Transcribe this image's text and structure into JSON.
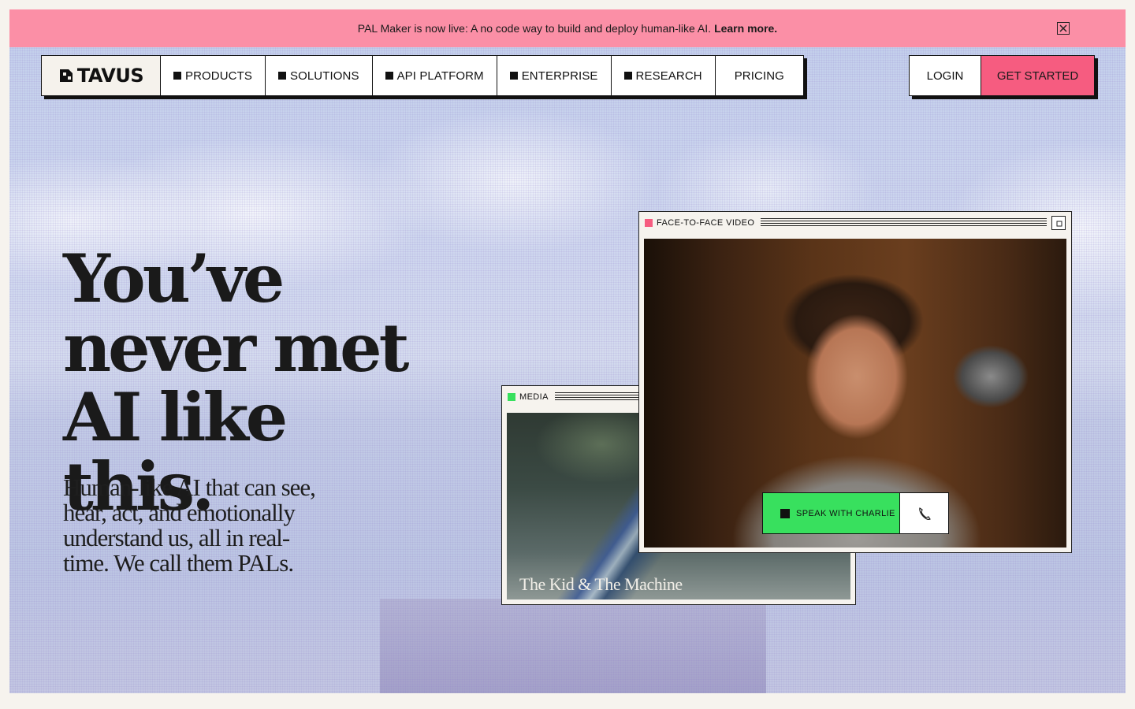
{
  "banner": {
    "text": "PAL Maker is now live: A no code way to build and deploy human-like AI.",
    "link": "Learn more.",
    "close_icon": "close-box-icon",
    "color": "#fb8fa6"
  },
  "nav": {
    "logo": "TAVUS",
    "items": [
      {
        "label": "PRODUCTS"
      },
      {
        "label": "SOLUTIONS"
      },
      {
        "label": "API PLATFORM"
      },
      {
        "label": "ENTERPRISE"
      },
      {
        "label": "RESEARCH"
      },
      {
        "label": "PRICING"
      }
    ],
    "login": "LOGIN",
    "get_started": "GET STARTED",
    "accent": "#f65c80"
  },
  "hero": {
    "headline_lines": [
      "You’ve",
      "never met",
      "AI like this."
    ],
    "subhead": "Human-like AI that can see, hear, act, and emotionally understand us, all in real-time. We call them PALs."
  },
  "media_window": {
    "title": "MEDIA",
    "dot_color": "#38e05e",
    "caption": "The Kid & The Machine"
  },
  "video_window": {
    "title": "FACE-TO-FACE VIDEO",
    "dot_color": "#f65c80",
    "expand_icon": "expand-icon",
    "cta": "SPEAK WITH CHARLIE",
    "cta_color": "#38e05e",
    "phone_icon": "phone-icon"
  }
}
